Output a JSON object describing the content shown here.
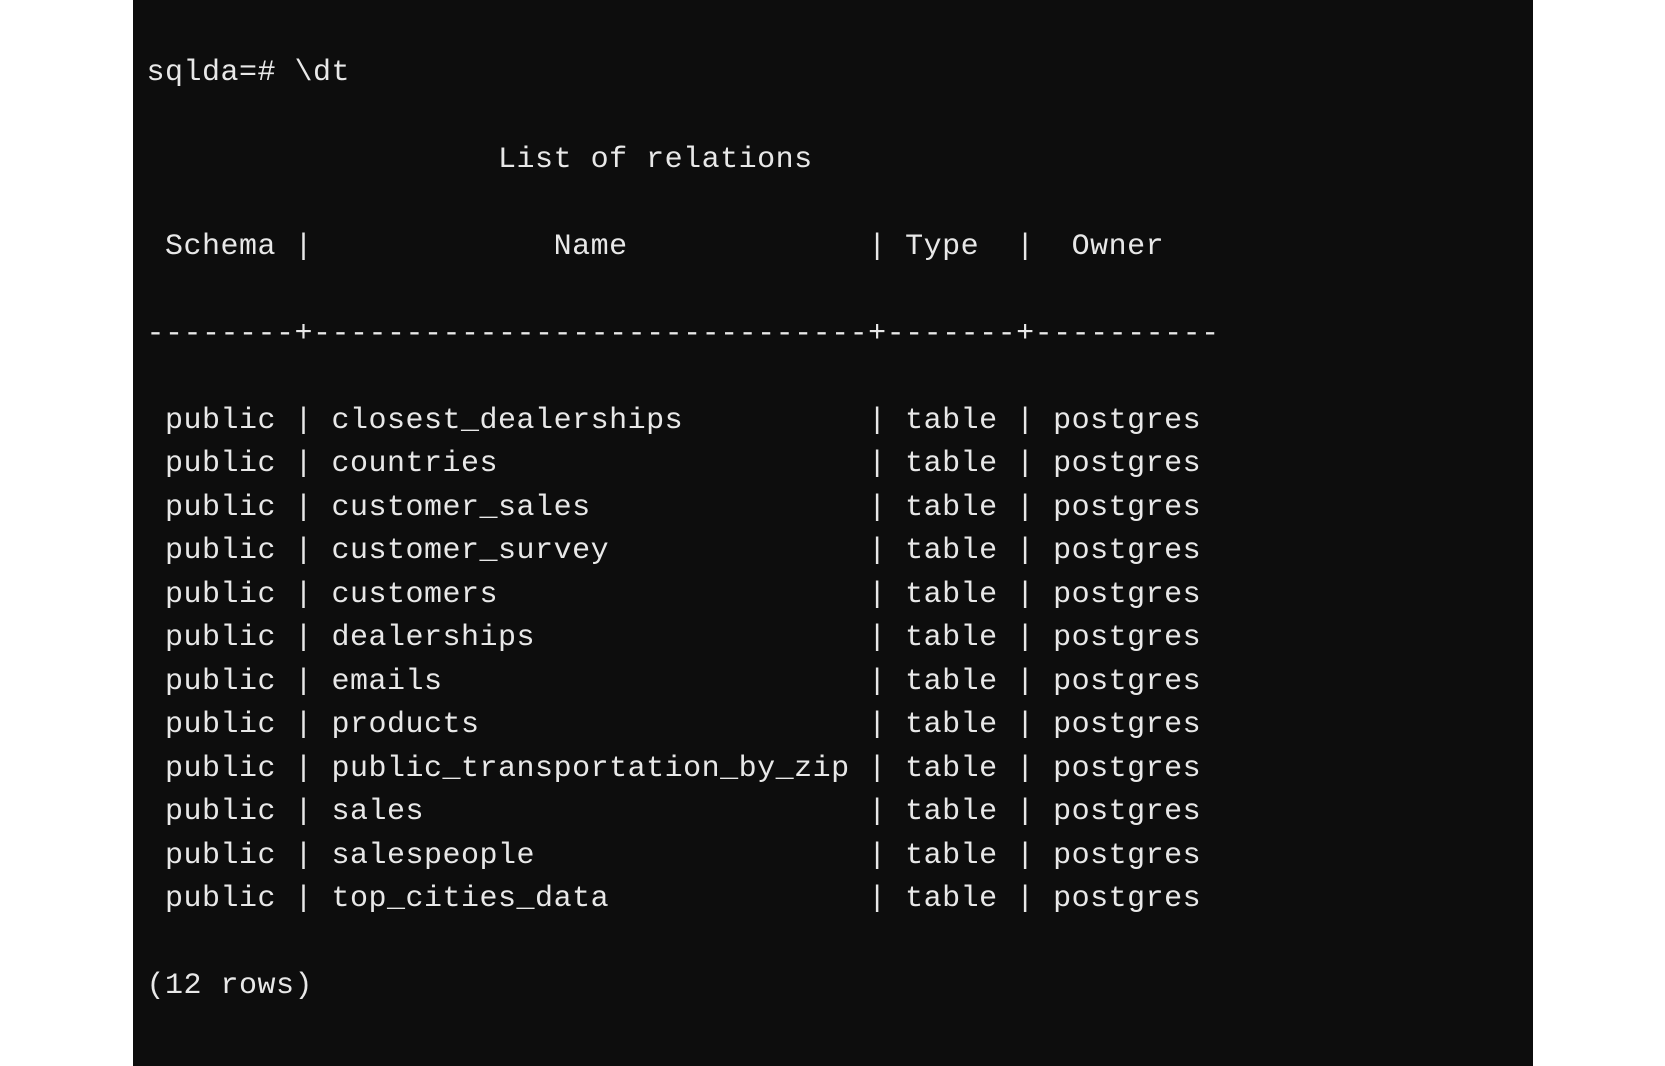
{
  "prompt": "sqlda=# \\dt",
  "title": "                   List of relations",
  "headers": {
    "schema": "Schema",
    "name": "Name",
    "type": "Type",
    "owner": "Owner"
  },
  "header_line": " Schema |             Name             | Type  |  Owner",
  "divider": "--------+------------------------------+-------+----------",
  "rows": [
    {
      "schema": "public",
      "name": "closest_dealerships",
      "type": "table",
      "owner": "postgres"
    },
    {
      "schema": "public",
      "name": "countries",
      "type": "table",
      "owner": "postgres"
    },
    {
      "schema": "public",
      "name": "customer_sales",
      "type": "table",
      "owner": "postgres"
    },
    {
      "schema": "public",
      "name": "customer_survey",
      "type": "table",
      "owner": "postgres"
    },
    {
      "schema": "public",
      "name": "customers",
      "type": "table",
      "owner": "postgres"
    },
    {
      "schema": "public",
      "name": "dealerships",
      "type": "table",
      "owner": "postgres"
    },
    {
      "schema": "public",
      "name": "emails",
      "type": "table",
      "owner": "postgres"
    },
    {
      "schema": "public",
      "name": "products",
      "type": "table",
      "owner": "postgres"
    },
    {
      "schema": "public",
      "name": "public_transportation_by_zip",
      "type": "table",
      "owner": "postgres"
    },
    {
      "schema": "public",
      "name": "sales",
      "type": "table",
      "owner": "postgres"
    },
    {
      "schema": "public",
      "name": "salespeople",
      "type": "table",
      "owner": "postgres"
    },
    {
      "schema": "public",
      "name": "top_cities_data",
      "type": "table",
      "owner": "postgres"
    }
  ],
  "row_count": "(12 rows)",
  "col_widths": {
    "schema": 8,
    "name": 30,
    "type": 7,
    "owner": 10
  }
}
